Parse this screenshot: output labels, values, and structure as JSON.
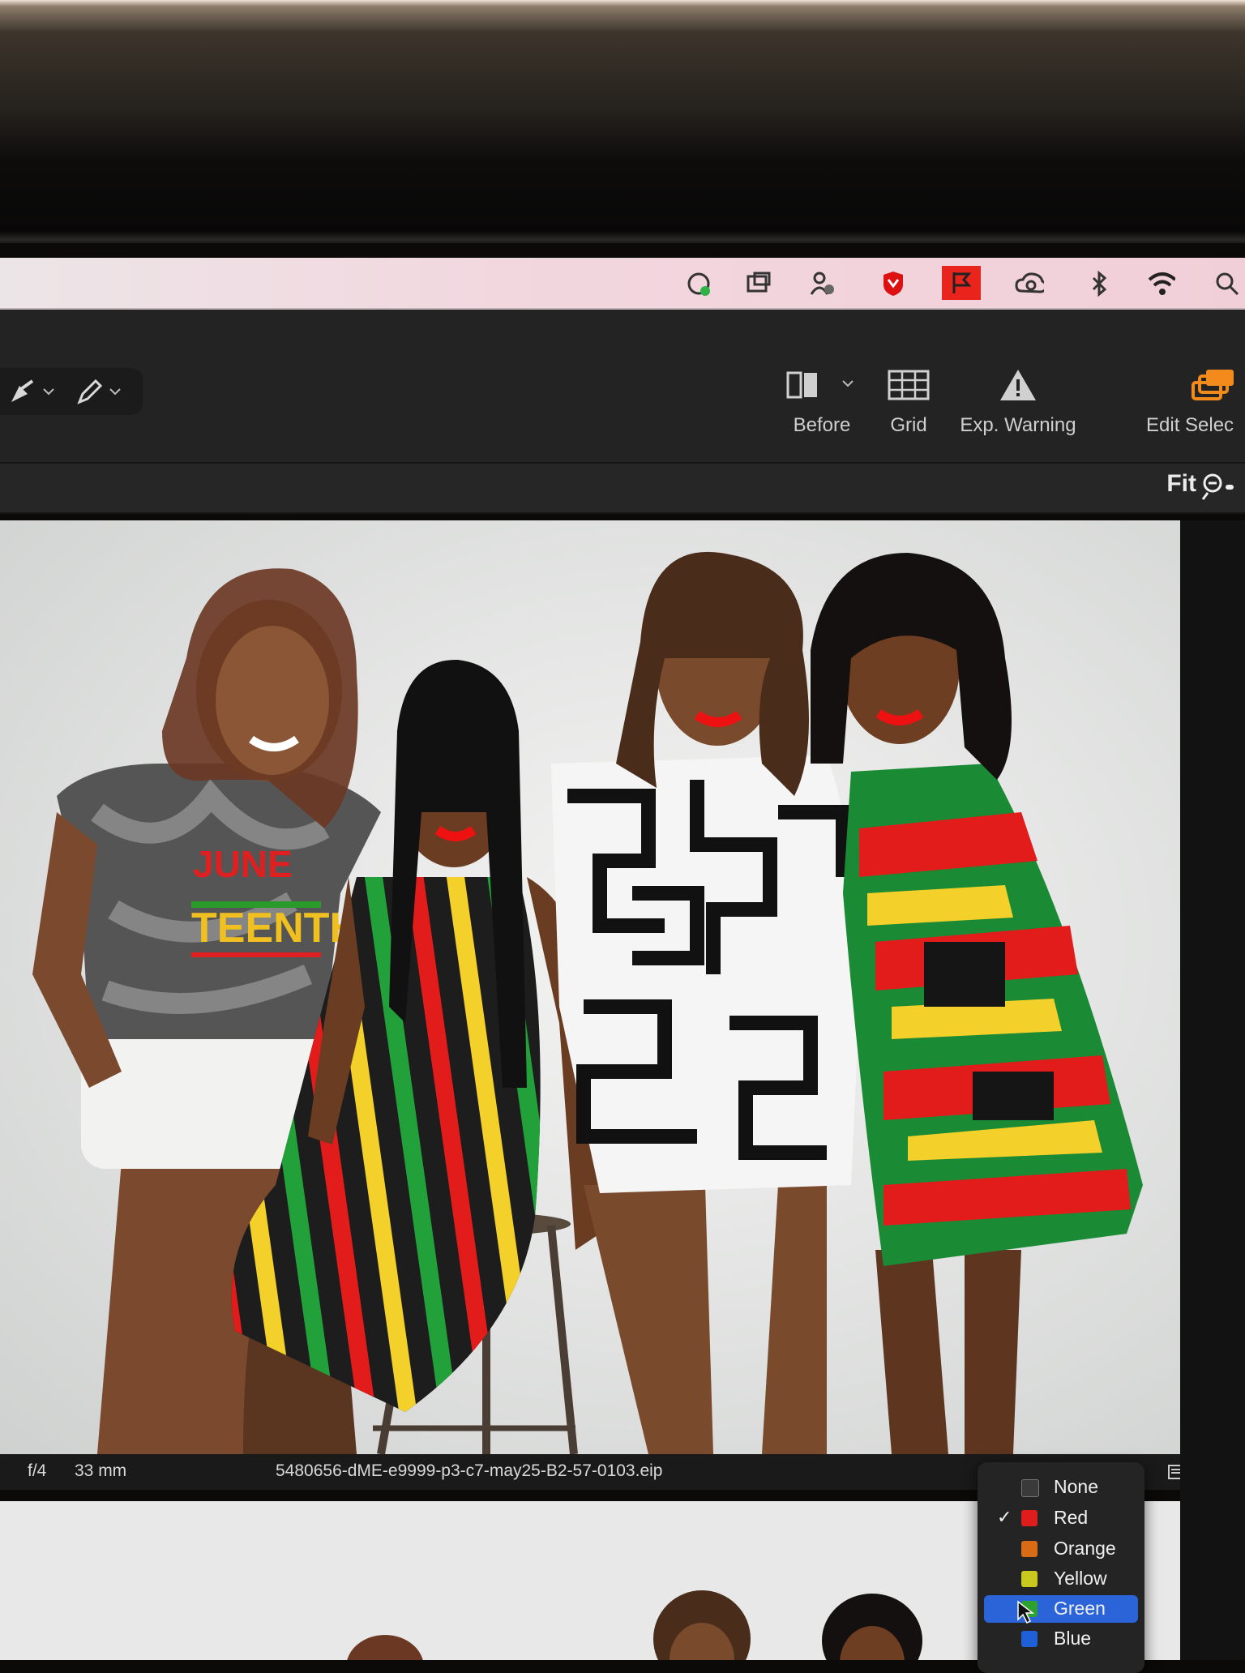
{
  "menubar": {
    "icons": [
      "sync-icon",
      "screenshot-icon",
      "user-lock-icon",
      "mcafee-icon",
      "flag-icon",
      "creative-cloud-icon",
      "bluetooth-icon",
      "wifi-icon",
      "search-icon"
    ]
  },
  "toolbar": {
    "before_label": "Before",
    "grid_label": "Grid",
    "exp_warning_label": "Exp. Warning",
    "edit_select_label": "Edit Selec"
  },
  "zoom": {
    "fit_label": "Fit"
  },
  "infobar": {
    "aperture": "f/4",
    "focal_length": "33 mm",
    "filename": "5480656-dME-e9999-p3-c7-may25-B2-57-0103.eip"
  },
  "color_label_menu": {
    "items": [
      {
        "label": "None",
        "color": "#3a3a3a",
        "checked": false,
        "selected": false
      },
      {
        "label": "Red",
        "color": "#e01d1d",
        "checked": true,
        "selected": false
      },
      {
        "label": "Orange",
        "color": "#d96a16",
        "checked": false,
        "selected": false
      },
      {
        "label": "Yellow",
        "color": "#c8c81e",
        "checked": false,
        "selected": false
      },
      {
        "label": "Green",
        "color": "#2ea02e",
        "checked": false,
        "selected": true
      },
      {
        "label": "Blue",
        "color": "#1f5fd8",
        "checked": false,
        "selected": false
      }
    ]
  },
  "colors": {
    "accent_orange": "#f28a1c",
    "selection_blue": "#2a64d8"
  }
}
